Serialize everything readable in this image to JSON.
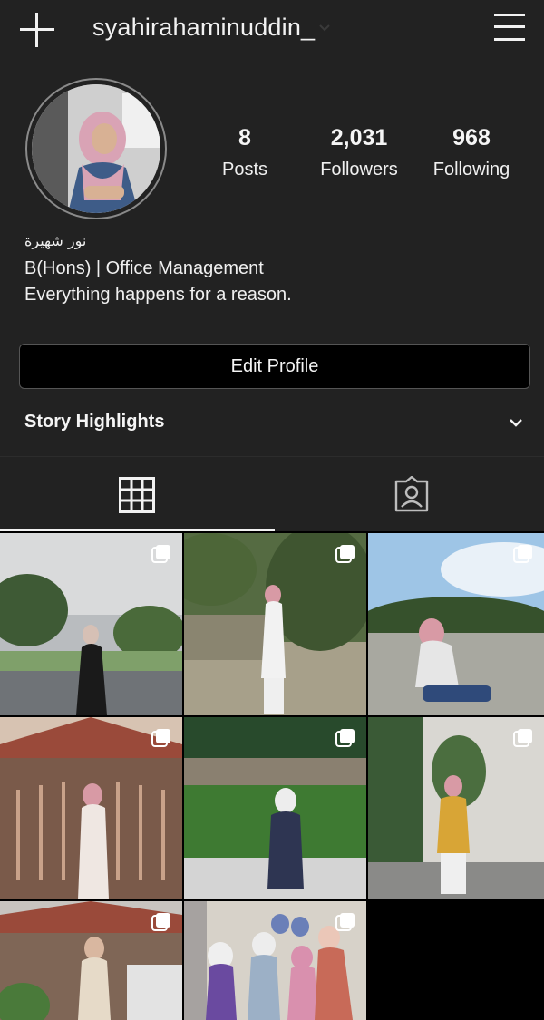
{
  "header": {
    "username": "syahirahaminuddin_",
    "icons": [
      "plus-icon",
      "chevron-down-icon",
      "hamburger-menu-icon"
    ]
  },
  "profile": {
    "stats": {
      "posts": {
        "value": "8",
        "label": "Posts"
      },
      "followers": {
        "value": "2,031",
        "label": "Followers"
      },
      "following": {
        "value": "968",
        "label": "Following"
      }
    },
    "bio": {
      "name": "نور شهيرة",
      "line1": "B(Hons) | Office Management",
      "line2": "Everything happens for a reason."
    },
    "edit_button_label": "Edit Profile",
    "highlights_label": "Story Highlights"
  },
  "tabs": {
    "active": "grid",
    "items": [
      "grid-icon",
      "tagged-icon"
    ]
  },
  "posts": [
    {
      "scene": "girl in black dress on road under grey sky",
      "multi": true
    },
    {
      "scene": "girl in white outfit in forest park",
      "multi": true
    },
    {
      "scene": "girl in pink hijab sitting on skate park ramp",
      "multi": true
    },
    {
      "scene": "girl in pink hijab in front of house gate",
      "multi": true
    },
    {
      "scene": "girl in white hijab sitting by green hedge",
      "multi": true
    },
    {
      "scene": "girl in yellow top with potted plant",
      "multi": true
    },
    {
      "scene": "girl in beige outfit in front of house",
      "multi": true
    },
    {
      "scene": "family group photo",
      "multi": true
    }
  ]
}
